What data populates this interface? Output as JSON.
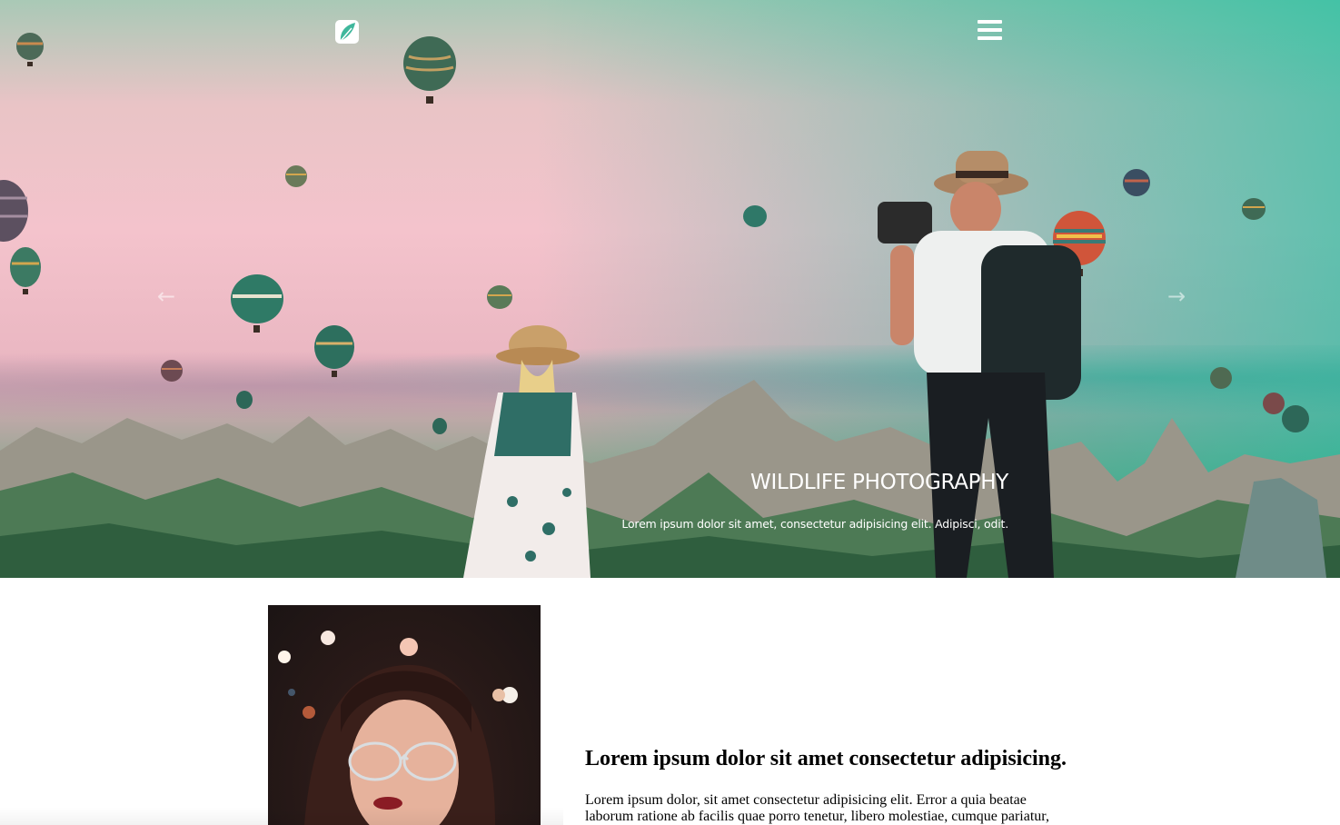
{
  "nav": {
    "logo_icon": "leaf-logo-icon",
    "menu_icon": "hamburger-menu-icon"
  },
  "slider": {
    "prev_icon": "arrow-left-icon",
    "next_icon": "arrow-right-icon",
    "title": "WILDLIFE PHOTOGRAPHY",
    "subtitle": "Lorem ipsum dolor sit amet, consectetur adipisicing elit. Adipisci, odit."
  },
  "content": {
    "heading": "Lorem ipsum dolor sit amet consectetur adipisicing.",
    "paragraph": "Lorem ipsum dolor, sit amet consectetur adipisicing elit. Error a quia beatae laborum ratione ab facilis quae porro tenetur, libero molestiae, cumque pariatur,"
  },
  "colors": {
    "accent_teal": "#00b89a",
    "text_white": "#ffffff",
    "text_black": "#000000"
  }
}
